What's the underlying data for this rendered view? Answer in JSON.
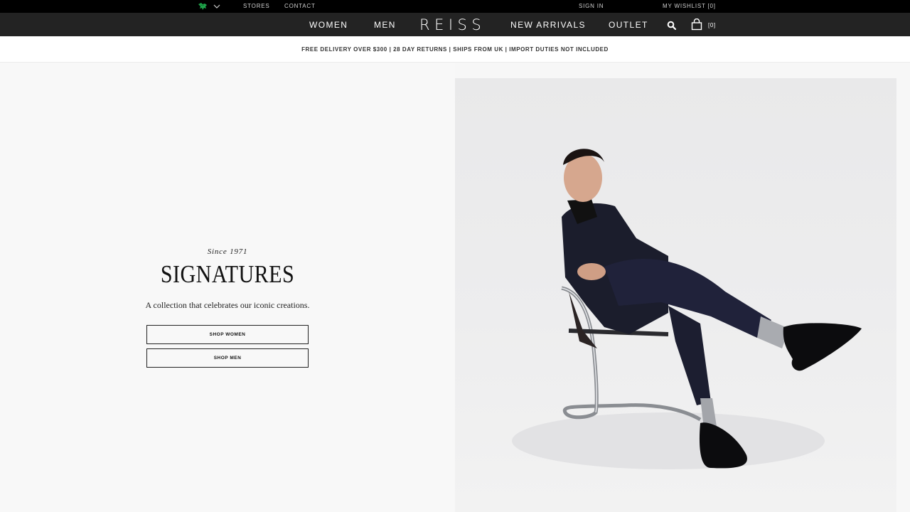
{
  "utility": {
    "stores": "STORES",
    "contact": "CONTACT",
    "sign_in": "SIGN IN",
    "wishlist": "MY WISHLIST [0]"
  },
  "nav": {
    "women": "WOMEN",
    "men": "MEN",
    "logo": "REISS",
    "new_arrivals": "NEW ARRIVALS",
    "outlet": "OUTLET",
    "bag_count": "[0]"
  },
  "promo": {
    "text": "FREE DELIVERY OVER $300 | 28 DAY RETURNS | SHIPS FROM UK | IMPORT DUTIES NOT INCLUDED"
  },
  "hero": {
    "eyebrow": "Since 1971",
    "title": "SIGNATURES",
    "description": "A collection that celebrates our iconic creations.",
    "shop_women": "SHOP WOMEN",
    "shop_men": "SHOP MEN"
  },
  "icons": {
    "country": "globe-flag-icon",
    "dropdown": "chevron-down-icon",
    "search": "search-icon",
    "bag": "shopping-bag-icon"
  },
  "colors": {
    "top_bar": "#000000",
    "nav_bar": "#232323",
    "flag_green": "#1fa34a",
    "page_bg": "#f8f8f8"
  }
}
